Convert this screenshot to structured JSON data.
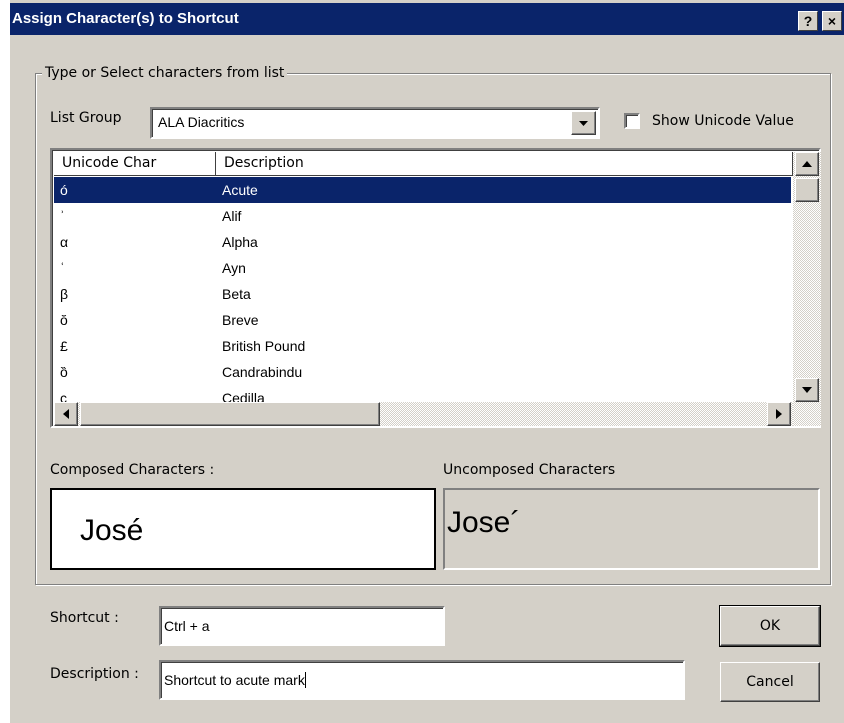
{
  "dialog": {
    "title": "Assign Character(s) to Shortcut",
    "help_label": "?",
    "close_label": "×"
  },
  "group": {
    "legend": "Type or Select characters from list"
  },
  "list_group": {
    "label": "List Group",
    "selected": "ALA Diacritics",
    "show_unicode_label": "Show Unicode Value",
    "show_unicode_checked": false
  },
  "table": {
    "columns": [
      "Unicode Char",
      "Description"
    ],
    "rows": [
      {
        "char": "ó",
        "desc": "Acute",
        "selected": true
      },
      {
        "char": "ʾ",
        "desc": "Alif"
      },
      {
        "char": "α",
        "desc": "Alpha"
      },
      {
        "char": "ʿ",
        "desc": "Ayn"
      },
      {
        "char": "β",
        "desc": "Beta"
      },
      {
        "char": "ŏ",
        "desc": "Breve"
      },
      {
        "char": "£",
        "desc": "British Pound"
      },
      {
        "char": "ȍ",
        "desc": "Candrabindu"
      },
      {
        "char": "ç",
        "desc": "Cedilla"
      }
    ]
  },
  "composed": {
    "label": "Composed Characters :",
    "value": "José"
  },
  "uncomposed": {
    "label": "Uncomposed Characters",
    "value": "Jose´"
  },
  "shortcut": {
    "label": "Shortcut :",
    "value": "Ctrl + a"
  },
  "description": {
    "label": "Description :",
    "value": "Shortcut to acute mark"
  },
  "buttons": {
    "ok": "OK",
    "cancel": "Cancel"
  }
}
